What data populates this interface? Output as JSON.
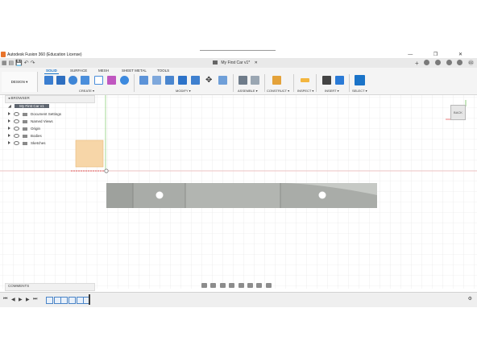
{
  "app": {
    "window_title": "Autodesk Fusion 360 (Education License)",
    "document_tab": "My First Car v1*"
  },
  "ribbon": {
    "categories": [
      "SOLID",
      "SURFACE",
      "MESH",
      "SHEET METAL",
      "TOOLS"
    ],
    "workspace": "DESIGN ▾",
    "groups": [
      "CREATE ▾",
      "MODIFY ▾",
      "ASSEMBLE ▾",
      "CONSTRUCT ▾",
      "INSPECT ▾",
      "INSERT ▾",
      "SELECT ▾"
    ]
  },
  "browser": {
    "title": "BROWSER",
    "root": "My First Car v1",
    "items": [
      "Document Settings",
      "Named Views",
      "Origin",
      "Bodies",
      "Sketches"
    ]
  },
  "viewcube": {
    "label": "BACK"
  },
  "comments": {
    "title": "COMMENTS"
  },
  "colors": {
    "accent": "#1a73c8",
    "part_fill": "#a7aaa6",
    "origin_plane": "#f7d6a8"
  }
}
